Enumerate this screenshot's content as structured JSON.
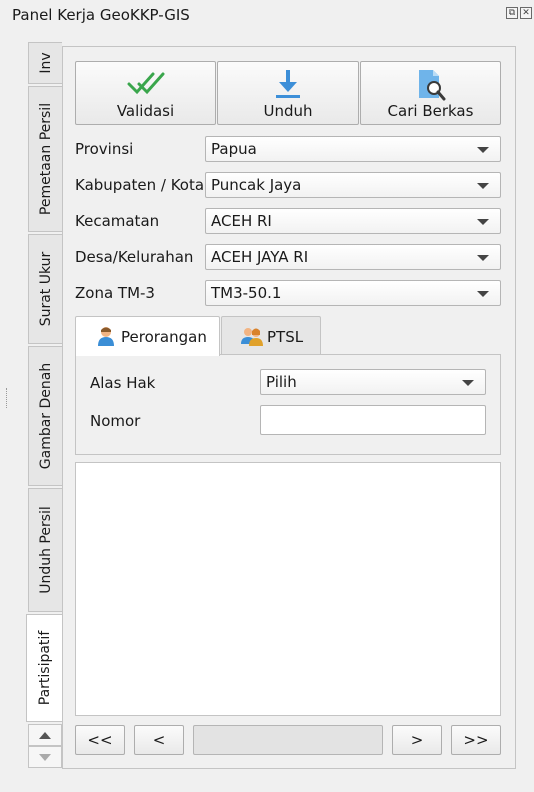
{
  "window": {
    "title": "Panel Kerja GeoKKP-GIS",
    "float_button": "⧉",
    "close_button": "✕"
  },
  "side_tabs": [
    {
      "label": "Inv",
      "active": false
    },
    {
      "label": "Pemetaan Persil",
      "active": false
    },
    {
      "label": "Surat Ukur",
      "active": false
    },
    {
      "label": "Gambar Denah",
      "active": false
    },
    {
      "label": "Unduh Persil",
      "active": false
    },
    {
      "label": "Partisipatif",
      "active": true
    }
  ],
  "toolbar": {
    "validate_label": "Validasi",
    "download_label": "Unduh",
    "search_files_label": "Cari Berkas"
  },
  "form": {
    "province": {
      "label": "Provinsi",
      "value": "Papua"
    },
    "regency": {
      "label": "Kabupaten / Kota",
      "value": "Puncak Jaya"
    },
    "district": {
      "label": "Kecamatan",
      "value": "ACEH RI"
    },
    "village": {
      "label": "Desa/Kelurahan",
      "value": "ACEH JAYA RI"
    },
    "zone": {
      "label": "Zona TM-3",
      "value": "TM3-50.1"
    }
  },
  "tabs": {
    "individual": "Perorangan",
    "ptsl": "PTSL"
  },
  "rights": {
    "basis_label": "Alas Hak",
    "basis_value": "Pilih",
    "number_label": "Nomor",
    "number_value": ""
  },
  "navigation": {
    "first": "<<",
    "prev": "<",
    "page_value": "",
    "next": ">",
    "last": ">>"
  },
  "colors": {
    "check_green": "#3aa64c",
    "download_blue": "#3d8fd8",
    "file_blue": "#6fb4ea"
  }
}
